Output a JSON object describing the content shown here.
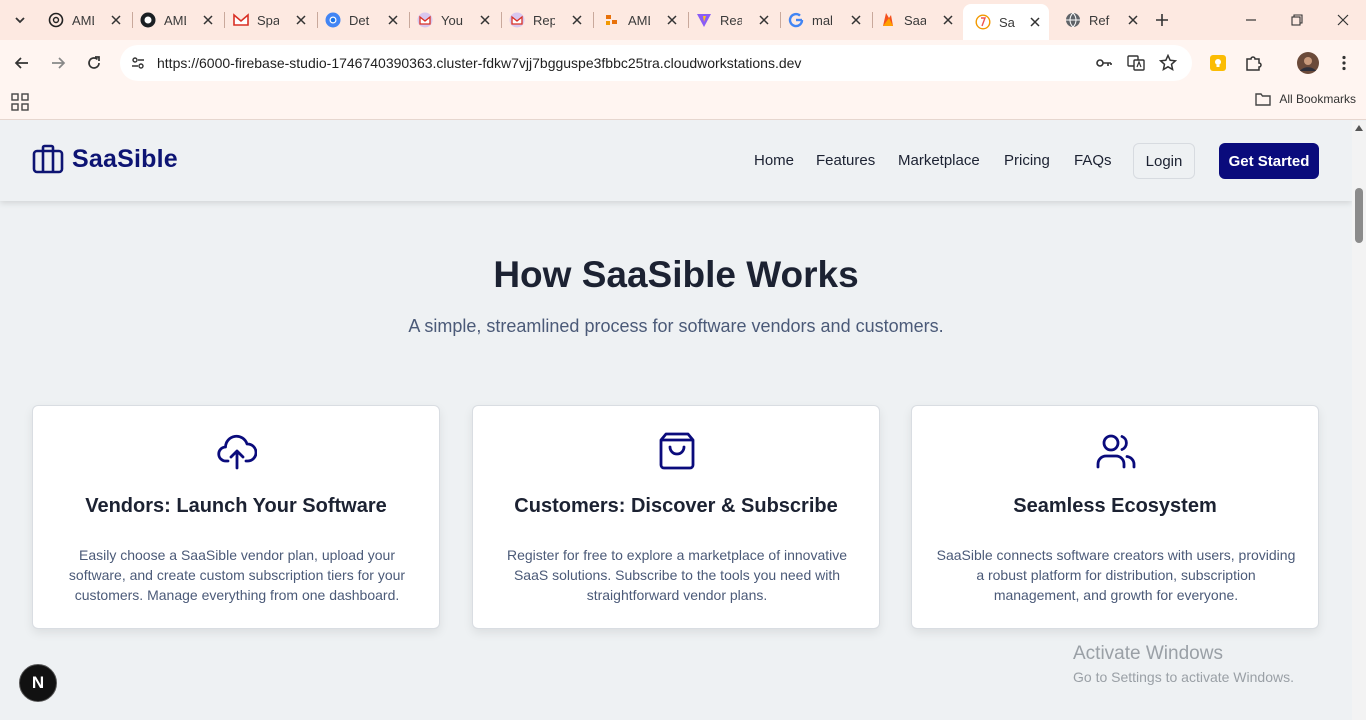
{
  "browser": {
    "tabs": [
      {
        "title": "AML",
        "icon": "openai-icon"
      },
      {
        "title": "AML",
        "icon": "github-icon"
      },
      {
        "title": "Spa",
        "icon": "gmail-icon"
      },
      {
        "title": "Det",
        "icon": "chrome-icon"
      },
      {
        "title": "You",
        "icon": "gmail-icon"
      },
      {
        "title": "Rep",
        "icon": "gmail-icon"
      },
      {
        "title": "AML",
        "icon": "app-icon"
      },
      {
        "title": "Rea",
        "icon": "vite-icon"
      },
      {
        "title": "mal",
        "icon": "google-icon"
      },
      {
        "title": "Saa",
        "icon": "firebase-icon"
      },
      {
        "title": "Saa",
        "icon": "firebase-studio-icon",
        "active": true
      },
      {
        "title": "Ref",
        "icon": "globe-icon"
      }
    ],
    "url": "https://6000-firebase-studio-1746740390363.cluster-fdkw7vjj7bgguspe3fbbc25tra.cloudworkstations.dev",
    "bookmarks_label": "All Bookmarks"
  },
  "site": {
    "brand": "SaaSible",
    "nav": [
      "Home",
      "Features",
      "Marketplace",
      "Pricing",
      "FAQs"
    ],
    "login_label": "Login",
    "cta_label": "Get Started"
  },
  "hero": {
    "title": "How SaaSible Works",
    "subtitle": "A simple, streamlined process for software vendors and customers."
  },
  "cards": [
    {
      "icon": "cloud-upload-icon",
      "title": "Vendors: Launch Your Software",
      "description": "Easily choose a SaaSible vendor plan, upload your software, and create custom subscription tiers for your customers. Manage everything from one dashboard."
    },
    {
      "icon": "shopping-bag-icon",
      "title": "Customers: Discover & Subscribe",
      "description": "Register for free to explore a marketplace of innovative SaaS solutions. Subscribe to the tools you need with straightforward vendor plans."
    },
    {
      "icon": "users-icon",
      "title": "Seamless Ecosystem",
      "description": "SaaSible connects software creators with users, providing a robust platform for distribution, subscription management, and growth for everyone."
    }
  ],
  "overlay": {
    "next_badge": "N",
    "activate_title": "Activate Windows",
    "activate_sub": "Go to Settings to activate Windows."
  },
  "colors": {
    "brand": "#0d1473",
    "cta": "#0a0b7c",
    "page_bg": "#eef1f3",
    "tabstrip": "#fde9e1"
  }
}
